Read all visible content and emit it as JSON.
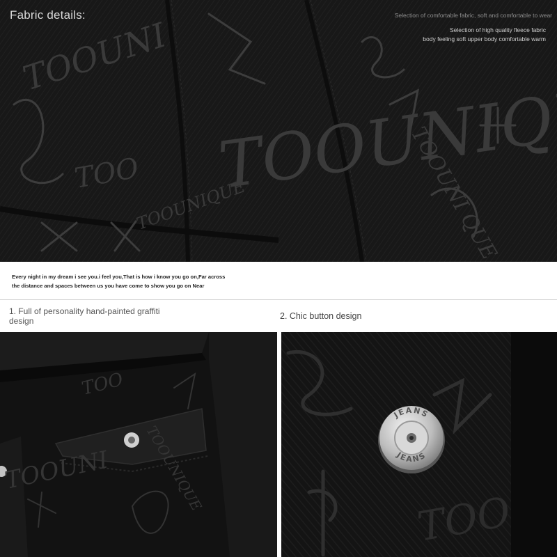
{
  "top": {
    "title": "Fabric details:",
    "desc_line_1": "Selection of comfortable fabric, soft and comfortable to wear",
    "desc_line_2": "Selection of high quality fleece fabric",
    "desc_line_3": "body feeling soft upper body comfortable warm",
    "graffiti_words": [
      "TOOUNIQUE",
      "TOOUNI",
      "TOO",
      "TOOUNI QUE",
      "TOOUNIQUE"
    ]
  },
  "quote": {
    "line_1": "Every night in my dream i see you.i feel you,That is how i know you go on,Far across",
    "line_2": "the distance and spaces between us you have come to show you go on Near"
  },
  "captions": {
    "left": "1. Full of personality hand-painted graffiti design",
    "right": "2. Chic button design"
  },
  "button": {
    "text_top": "JEANS",
    "text_bottom": "JEANS"
  },
  "colors": {
    "fabric": "#161616",
    "graffiti": "#3a3a3a",
    "button_metal": "#c8c8c8"
  }
}
